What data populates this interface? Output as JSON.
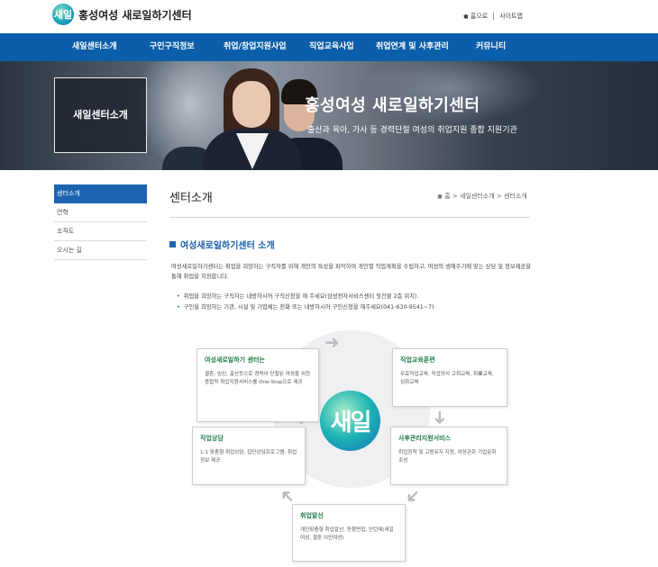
{
  "header": {
    "logo_mark": "새일",
    "logo_text": "홍성여성 새로일하기센터",
    "util_home": "홈으로",
    "util_sitemap": "사이트맵"
  },
  "gnb": [
    "새일센터소개",
    "구인구직정보",
    "취업/창업지원사업",
    "직업교육사업",
    "취업연계 및 사후관리",
    "커뮤니티"
  ],
  "visual": {
    "box_title": "새일센터소개",
    "main_title": "홍성여성 새로일하기센터",
    "subtitle": "출산과 육아, 가사 등 경력단절 여성의 취업지원 종합 지원기관"
  },
  "lnb": [
    "센터소개",
    "연혁",
    "조직도",
    "오시는 길"
  ],
  "content": {
    "title": "센터소개",
    "location": [
      "홈",
      "새일센터소개",
      "센터소개"
    ],
    "section_title": "여성새로일하기센터 소개",
    "intro": "여성새로일하기센터는 취업을 희망하는 구직자를 위해 개인의 특성을 파악하여 개인별 직업계획을 수립하고, 여성의 생애주기에 맞는 상담 및 정보제공을 통해 취업을 지원합니다.",
    "bullets": [
      "취업을 희망하는 구직자는 내방하시어 구직신청을 해 주세요(삼성전자서비스센터 뒷건물 2층 위치).",
      "구인을 희망하는 기관, 시설 및 기업체는 전화 또는 내방하시어 구인신청을 해주세요(041-630-9541~7)"
    ]
  },
  "diagram": {
    "center": "새일",
    "cards": [
      {
        "title": "여성새로일하기 센터는",
        "desc": "결혼, 임신, 출산등으로 경력이 단절된 여성을 위한 종합적 취업지원서비스를 One-Stop으로 제공"
      },
      {
        "title": "직업교육훈련",
        "desc": "무료직업교육, 직업의식 고취교육, 취業교육, 심화교육"
      },
      {
        "title": "사후관리지원서비스",
        "desc": "취업정착 및 고용유지 지원, 여성관화 기업문화조성"
      },
      {
        "title": "취업알선",
        "desc": "개인맞춤형 취업알선, 동행면접, 인턴제(새일여성, 결혼 이민여성)"
      },
      {
        "title": "직업상담",
        "desc": "1:1 맞춤형 취업상담, 집단상담프로그램, 취업정보 제공"
      }
    ]
  }
}
